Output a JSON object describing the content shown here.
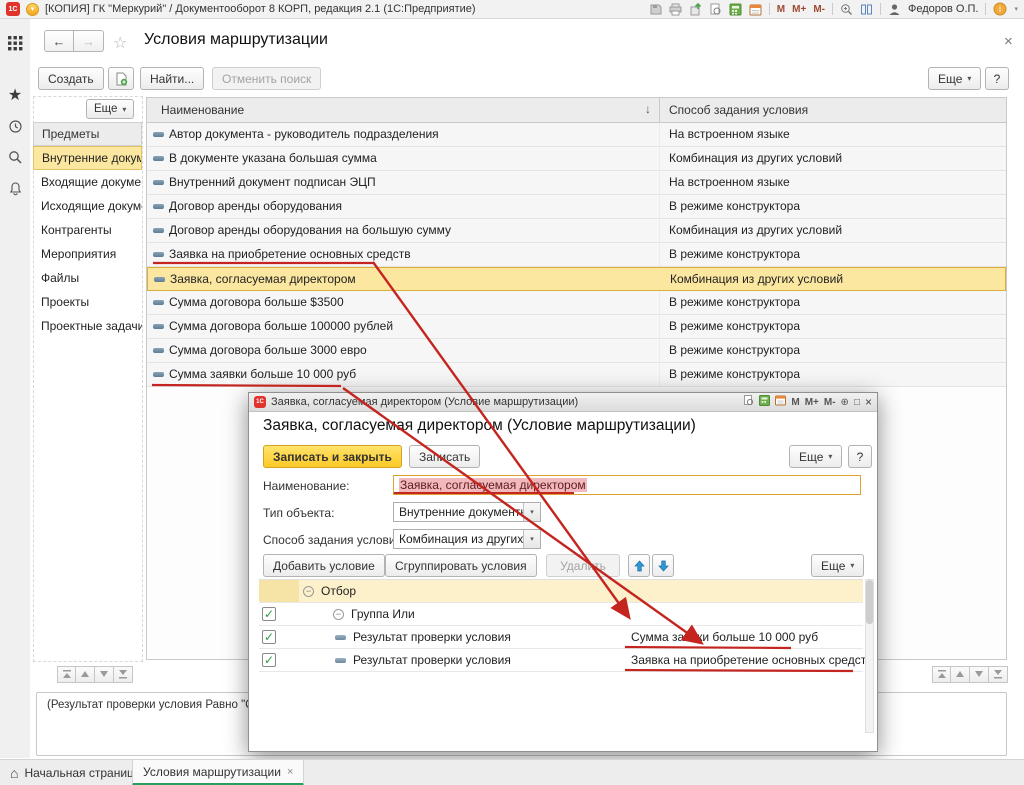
{
  "glyphs": {
    "logo": "1С",
    "back": "←",
    "forward": "→",
    "star": "☆",
    "close": "×",
    "sort_desc": "↓",
    "dropdown": "▾",
    "check": "✓",
    "minus_expander": "−",
    "home": "⌂",
    "m": "M",
    "m_plus": "M+",
    "m_minus": "M-",
    "info": "i",
    "zoom": "⊕",
    "maximize": "□",
    "help": "?"
  },
  "colors": {
    "selection_yellow": "#fbe7a0",
    "annotation_red": "#c4251f",
    "active_tab_green": "#27a05d",
    "primary_button_yellow": "#fbc926"
  },
  "system_bar": {
    "title": "[КОПИЯ] ГК \"Меркурий\" / Документооборот 8 КОРП, редакция 2.1  (1С:Предприятие)",
    "user": "Федоров О.П."
  },
  "window": {
    "title": "Условия маршрутизации",
    "toolbar": {
      "create": "Создать",
      "find": "Найти...",
      "cancel_search": "Отменить поиск",
      "more": "Еще",
      "help": "?"
    },
    "sidebar": {
      "more": "Еще",
      "header": "Предметы",
      "selected_index": 0,
      "items": [
        "Внутренние документы",
        "Входящие документы",
        "Исходящие документы",
        "Контрагенты",
        "Мероприятия",
        "Файлы",
        "Проекты",
        "Проектные задачи"
      ]
    },
    "table": {
      "columns": [
        "Наименование",
        "Способ задания условия"
      ],
      "selected_row_index": 6,
      "rows": [
        {
          "name": "Автор документа - руководитель подразделения",
          "method": "На встроенном языке"
        },
        {
          "name": "В документе указана большая сумма",
          "method": "Комбинация из других условий"
        },
        {
          "name": "Внутренний документ подписан ЭЦП",
          "method": "На встроенном языке"
        },
        {
          "name": "Договор аренды оборудования",
          "method": "В режиме конструктора"
        },
        {
          "name": "Договор аренды оборудования на большую сумму",
          "method": "Комбинация из других условий"
        },
        {
          "name": "Заявка на приобретение основных средств",
          "method": "В режиме конструктора",
          "annotated": true
        },
        {
          "name": "Заявка, согласуемая директором",
          "method": "Комбинация из других условий",
          "selected": true
        },
        {
          "name": "Сумма договора больше $3500",
          "method": "В режиме конструктора"
        },
        {
          "name": "Сумма договора больше 100000 рублей",
          "method": "В режиме конструктора"
        },
        {
          "name": "Сумма договора больше 3000 евро",
          "method": "В режиме конструктора"
        },
        {
          "name": "Сумма заявки больше 10 000 руб",
          "method": "В режиме конструктора",
          "annotated": true
        }
      ]
    },
    "status_text": "(Результат проверки условия Равно \"Сумм",
    "tabs": [
      {
        "label": "Начальная страница"
      },
      {
        "label": "Условия маршрутизации",
        "active": true
      }
    ]
  },
  "dialog": {
    "titlebar_title": "Заявка, согласуемая директором (Условие маршрутизации)",
    "heading": "Заявка, согласуемая директором (Условие маршрутизации)",
    "buttons": {
      "save_and_close": "Записать и закрыть",
      "save": "Записать",
      "more": "Еще",
      "help": "?"
    },
    "fields": {
      "name_label": "Наименование:",
      "name_value": "Заявка, согласуемая директором",
      "object_type_label": "Тип объекта:",
      "object_type_value": "Внутренние документы",
      "method_label": "Способ задания условия:",
      "method_value": "Комбинация из других ус"
    },
    "builder": {
      "add": "Добавить условие",
      "group": "Сгруппировать условия",
      "delete": "Удалить",
      "more": "Еще"
    },
    "tree": {
      "root": "Отбор",
      "group": "Группа Или",
      "rows": [
        {
          "label": "Результат проверки условия",
          "value": "Сумма заявки больше 10 000 руб"
        },
        {
          "label": "Результат проверки условия",
          "value": "Заявка на приобретение основных средств"
        }
      ]
    }
  }
}
